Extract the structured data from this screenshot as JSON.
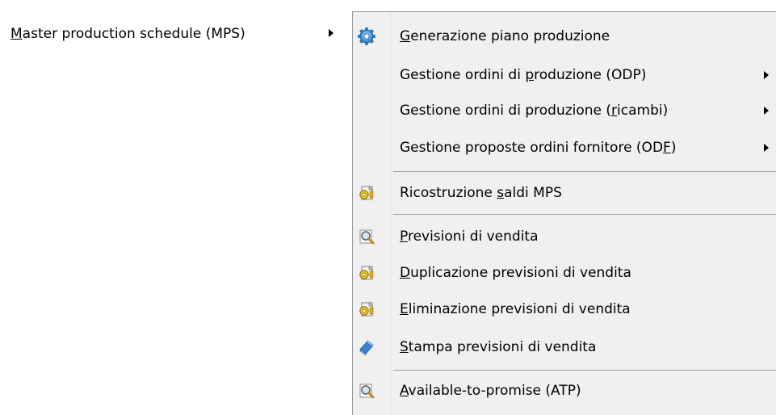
{
  "parent_menu": {
    "label_pre": "",
    "label_mn": "M",
    "label_post": "aster production schedule (MPS)"
  },
  "submenu": {
    "items": [
      {
        "pre": "",
        "mn": "G",
        "post": "enerazione piano produzione",
        "icon": "gear-icon",
        "has_submenu": false
      },
      {
        "pre": "Gestione ordini di ",
        "mn": "p",
        "post": "roduzione (ODP)",
        "icon": "",
        "has_submenu": true
      },
      {
        "pre": "Gestione ordini di produzione (",
        "mn": "r",
        "post": "icambi)",
        "icon": "",
        "has_submenu": true
      },
      {
        "pre": "Gestione proposte ordini fornitore (OD",
        "mn": "F",
        "post": ")",
        "icon": "",
        "has_submenu": true
      },
      {
        "pre": "Ricostruzione ",
        "mn": "s",
        "post": "aldi MPS",
        "icon": "process-icon",
        "has_submenu": false
      },
      {
        "pre": "",
        "mn": "P",
        "post": "revisioni di vendita",
        "icon": "magnifier-icon",
        "has_submenu": false
      },
      {
        "pre": "",
        "mn": "D",
        "post": "uplicazione previsioni di vendita",
        "icon": "process-icon",
        "has_submenu": false
      },
      {
        "pre": "",
        "mn": "E",
        "post": "liminazione previsioni di vendita",
        "icon": "process-icon",
        "has_submenu": false
      },
      {
        "pre": "",
        "mn": "S",
        "post": "tampa previsioni di vendita",
        "icon": "print-icon",
        "has_submenu": false
      },
      {
        "pre": "",
        "mn": "A",
        "post": "vailable-to-promise (ATP)",
        "icon": "magnifier-icon",
        "has_submenu": false
      }
    ]
  }
}
